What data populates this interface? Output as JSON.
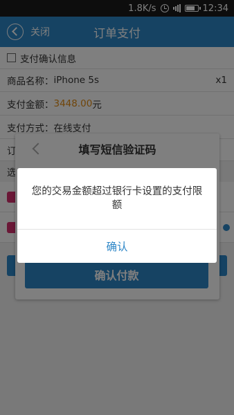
{
  "status_bar": {
    "speed": "1.8K/s",
    "time": "12:34",
    "icons": [
      "alarm-icon",
      "signal-icon",
      "battery-icon"
    ]
  },
  "header": {
    "back_label": "关闭",
    "title": "订单支付"
  },
  "order": {
    "confirm_info_label": "支付确认信息",
    "product_label": "商品名称：",
    "product_name": "iPhone 5s",
    "quantity": "x1",
    "amount_label": "支付金额：",
    "amount_value": "3448.00",
    "amount_unit": "元",
    "method_label": "支付方式：",
    "method_value": "在线支付",
    "partial_row_char": "订",
    "partial_select_char": "选"
  },
  "sms_dialog": {
    "title": "填写短信验证码",
    "confirm_button": "确认付款"
  },
  "alert": {
    "message": "您的交易金额超过银行卡设置的支付限额",
    "ok_button": "确认"
  },
  "colors": {
    "accent": "#2c86c7",
    "price": "#e08a12",
    "status_bar": "#1a1a1a"
  }
}
